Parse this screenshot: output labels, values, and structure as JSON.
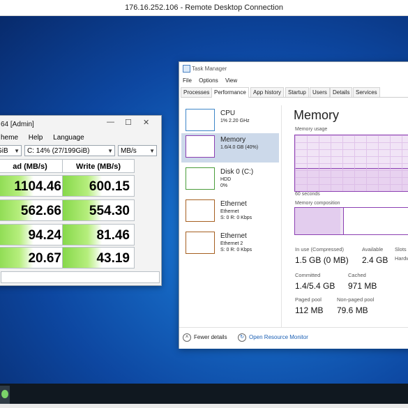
{
  "rdc": {
    "title": "176.16.252.106 - Remote Desktop Connection"
  },
  "cdm": {
    "title_partial": "64 [Admin]",
    "menu": [
      "heme",
      "Help",
      "Language"
    ],
    "size_select": "GiB",
    "drive_select": "C: 14% (27/199GiB)",
    "unit_select": "MB/s",
    "read_header": "ad (MB/s)",
    "write_header": "Write (MB/s)",
    "read": [
      "1104.46",
      "562.66",
      "94.24",
      "20.67"
    ],
    "write": [
      "600.15",
      "554.30",
      "81.46",
      "43.19"
    ]
  },
  "task_manager": {
    "title": "Task Manager",
    "menu": [
      "File",
      "Options",
      "View"
    ],
    "tabs": [
      "Processes",
      "Performance",
      "App history",
      "Startup",
      "Users",
      "Details",
      "Services"
    ],
    "active_tab": "Performance",
    "sidebar": [
      {
        "name": "CPU",
        "line1": "1% 2.20 GHz",
        "line2": ""
      },
      {
        "name": "Memory",
        "line1": "1.6/4.0 GB (40%)",
        "line2": ""
      },
      {
        "name": "Disk 0 (C:)",
        "line1": "HDD",
        "line2": "0%"
      },
      {
        "name": "Ethernet",
        "line1": "Ethernet",
        "line2": "S: 0 R: 0 Kbps"
      },
      {
        "name": "Ethernet",
        "line1": "Ethernet 2",
        "line2": "S: 0 R: 0 Kbps"
      }
    ],
    "memory": {
      "title": "Memory",
      "usage_label": "Memory usage",
      "seconds_label": "60 seconds",
      "composition_label": "Memory composition",
      "usage_fraction": 0.4,
      "in_use_label": "In use (Compressed)",
      "in_use": "1.5 GB (0 MB)",
      "available_label": "Available",
      "available": "2.4 GB",
      "slots_label": "Slots",
      "slots_value": "Hardw",
      "committed_label": "Committed",
      "committed": "1.4/5.4 GB",
      "cached_label": "Cached",
      "cached": "971 MB",
      "paged_label": "Paged pool",
      "paged": "112 MB",
      "nonpaged_label": "Non-paged pool",
      "nonpaged": "79.6 MB"
    },
    "footer": {
      "fewer": "Fewer details",
      "monitor": "Open Resource Monitor"
    }
  },
  "colors": {
    "memory_accent": "#8b3fb2",
    "cdm_green": "#86d84a",
    "desktop_blue": "#1565c0"
  },
  "icons": [
    "restore-icon",
    "minimize-icon",
    "close-icon",
    "chevron-up-icon",
    "resource-monitor-icon",
    "taskbar-app-icon"
  ]
}
